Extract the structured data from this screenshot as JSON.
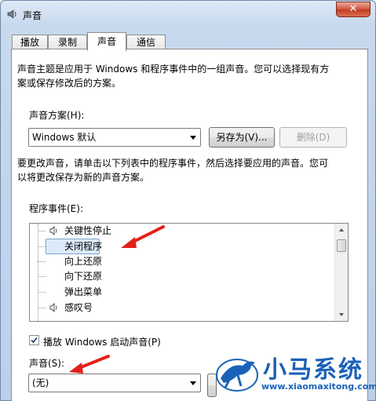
{
  "window": {
    "title": "声音"
  },
  "tabs": [
    {
      "label": "播放"
    },
    {
      "label": "录制"
    },
    {
      "label": "声音"
    },
    {
      "label": "通信"
    }
  ],
  "description": {
    "line1": "声音主题是应用于 Windows 和程序事件中的一组声音。您可以选择现有方",
    "line2": "案或保存修改后的方案。"
  },
  "scheme": {
    "label": "声音方案(H):",
    "selected": "Windows 默认",
    "save_as_label": "另存为(V)...",
    "delete_label": "删除(D)"
  },
  "instruction": {
    "line1": "要更改声音，请单击以下列表中的程序事件，然后选择要应用的声音。您可",
    "line2": "以将更改保存为新的声音方案。"
  },
  "events": {
    "label": "程序事件(E):",
    "items": [
      {
        "label": "关键性停止",
        "has_sound": true
      },
      {
        "label": "关闭程序",
        "has_sound": false,
        "selected": true
      },
      {
        "label": "向上还原",
        "has_sound": false
      },
      {
        "label": "向下还原",
        "has_sound": false
      },
      {
        "label": "弹出菜单",
        "has_sound": false
      },
      {
        "label": "感叹号",
        "has_sound": true
      }
    ]
  },
  "startup": {
    "label": "播放 Windows 启动声音(P)",
    "checked": true
  },
  "sound": {
    "label": "声音(S):",
    "selected": "(无)"
  },
  "watermark": {
    "title": "小马系统",
    "url": "www.xiaomaxitong.com"
  },
  "colors": {
    "accent": "#1a62b8",
    "annotation_red": "#e3201b",
    "selection": "#dcebfc"
  }
}
